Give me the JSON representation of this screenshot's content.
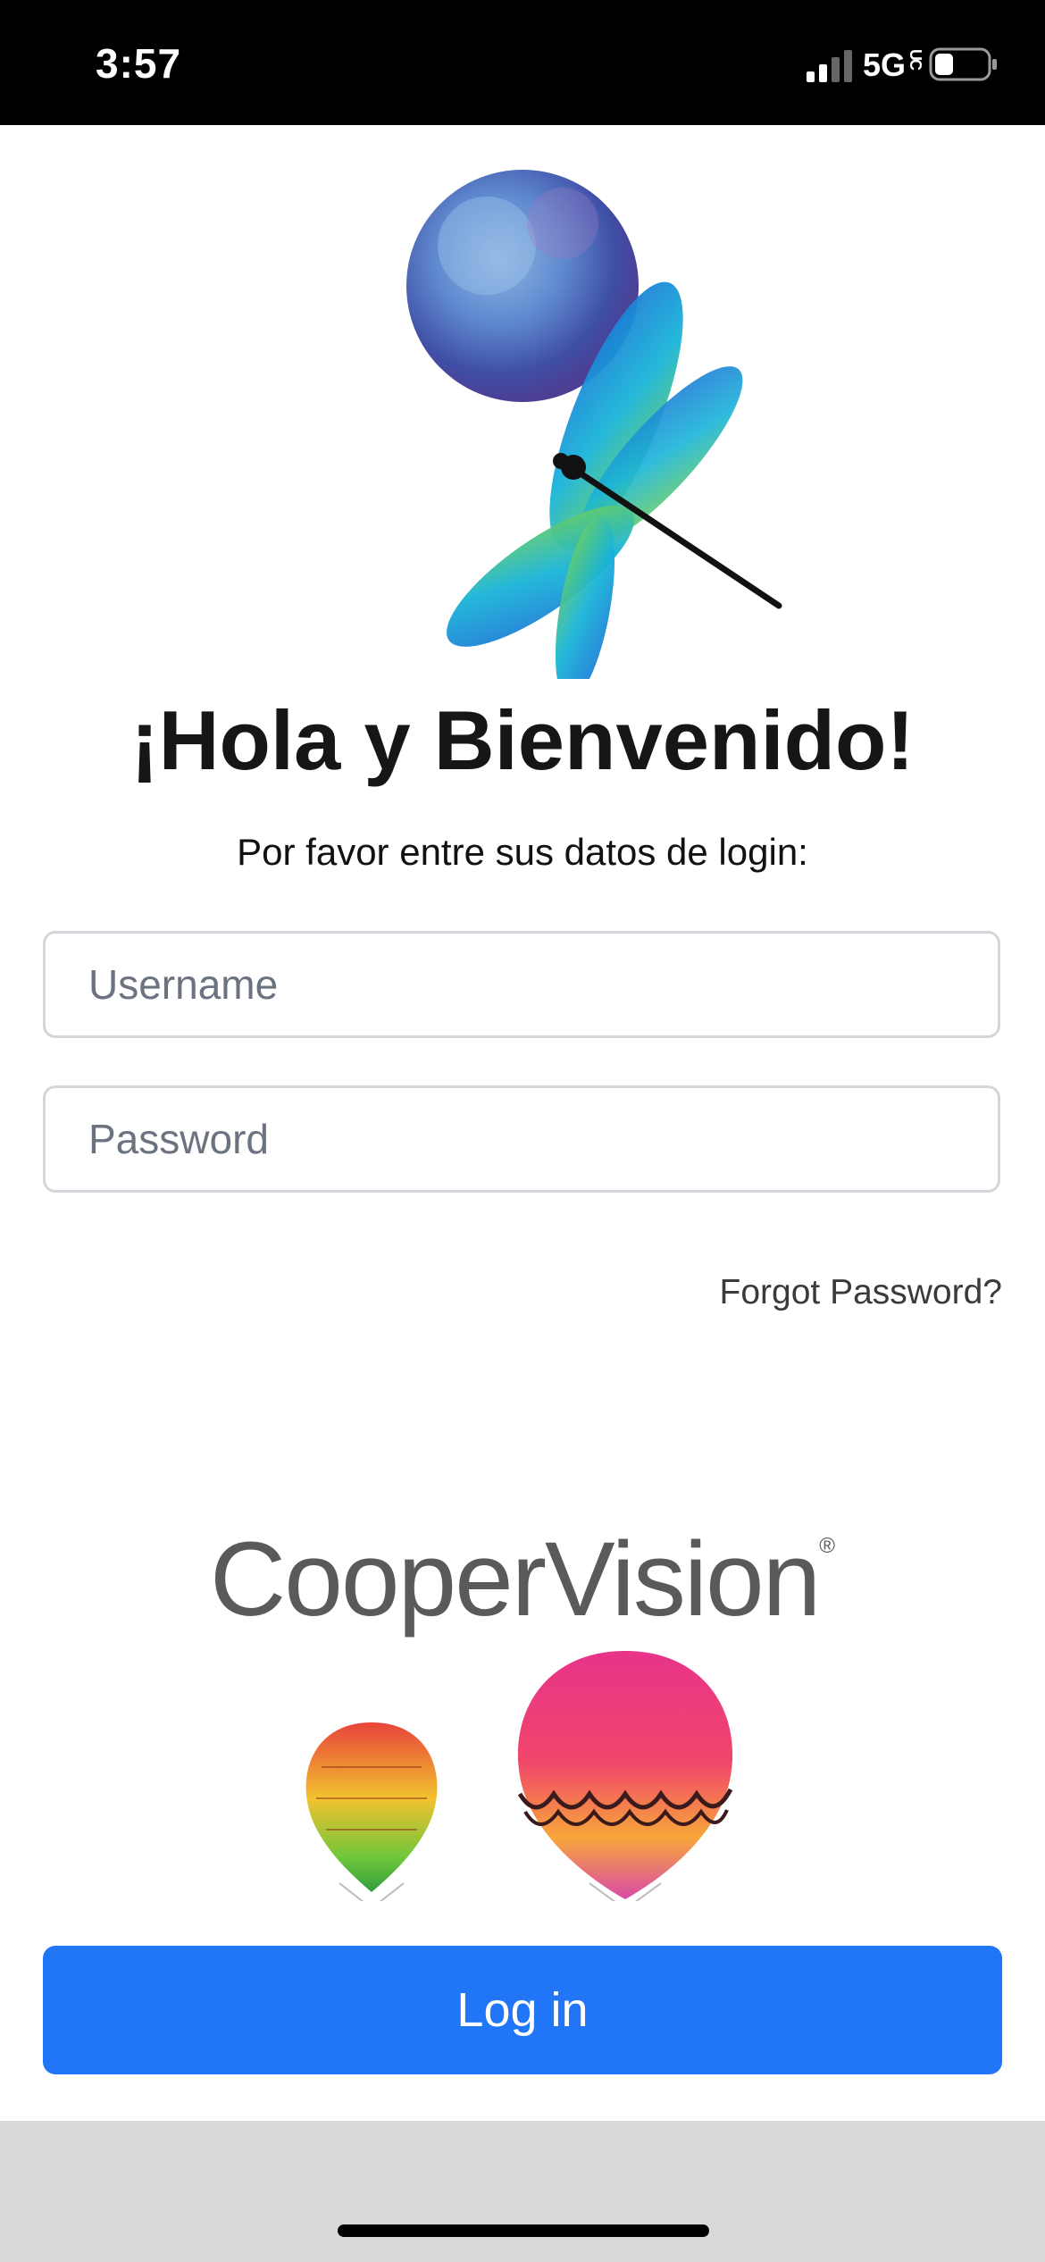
{
  "status_bar": {
    "time": "3:57",
    "network": "5G",
    "network_suffix": "UC"
  },
  "login": {
    "title": "¡Hola y Bienvenido!",
    "subtitle": "Por favor entre sus datos de login:",
    "username_placeholder": "Username",
    "password_placeholder": "Password",
    "forgot_password": "Forgot Password?",
    "login_button": "Log in"
  },
  "brand": {
    "name": "CooperVision",
    "registered_mark": "®"
  },
  "colors": {
    "primary_button": "#2175f7",
    "status_bar": "#000000",
    "title_text": "#161616"
  }
}
